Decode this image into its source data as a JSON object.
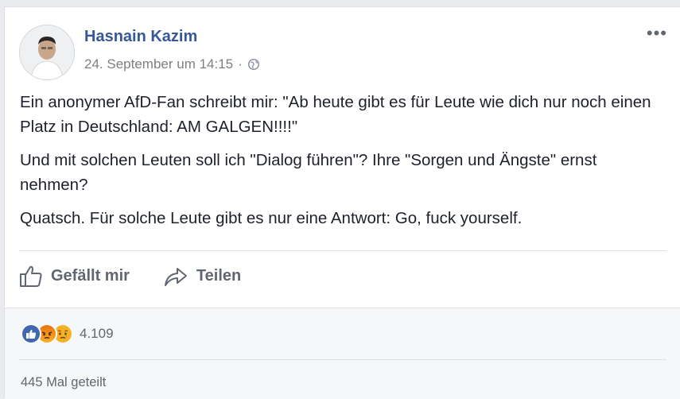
{
  "post": {
    "author": "Hasnain Kazim",
    "timestamp": "24. September um 14:15",
    "separator": "·",
    "audience_icon": "globe-icon",
    "more_icon": "more-options-icon",
    "more_label": "•••",
    "paragraphs": [
      "Ein anonymer AfD-Fan schreibt mir: \"Ab heute gibt es für Leute wie dich nur noch einen Platz in Deutschland: AM GALGEN!!!!\"",
      "Und mit solchen Leuten soll ich \"Dialog führen\"? Ihre \"Sorgen und Ängste\" ernst nehmen?",
      "Quatsch. Für solche Leute gibt es nur eine Antwort: Go, fuck yourself."
    ]
  },
  "actions": {
    "like_label": "Gefällt mir",
    "share_label": "Teilen"
  },
  "engagement": {
    "reaction_icons": [
      "like-reaction-icon",
      "angry-reaction-icon",
      "sad-reaction-icon"
    ],
    "reaction_count": "4.109",
    "shares_text": "445 Mal geteilt"
  },
  "colors": {
    "author_link": "#365899",
    "like_blue": "#4267b2",
    "reaction_yellow": "#f7b125",
    "angry_orange": "#e9710f"
  }
}
